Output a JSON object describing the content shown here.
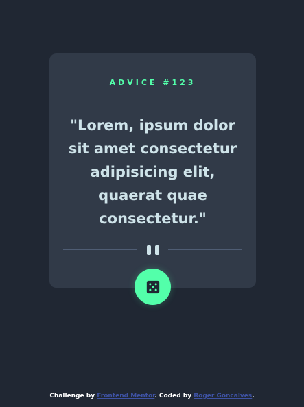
{
  "advice": {
    "label": "ADVICE #123",
    "quote": "\"Lorem, ipsum dolor sit amet consectetur adipisicing elit, quaerat quae consectetur.\""
  },
  "footer": {
    "challenge_by": "Challenge by ",
    "frontend_mentor": "Frontend Mentor",
    "coded_by": ". Coded by ",
    "author": "Roger Goncalves",
    "end": "."
  },
  "colors": {
    "background": "#202733",
    "card": "#313a48",
    "accent": "#53ffaa",
    "quote_text": "#cee3e9",
    "link": "#3e52a3"
  },
  "icons": {
    "divider": "pause-icon",
    "button": "dice-icon"
  }
}
